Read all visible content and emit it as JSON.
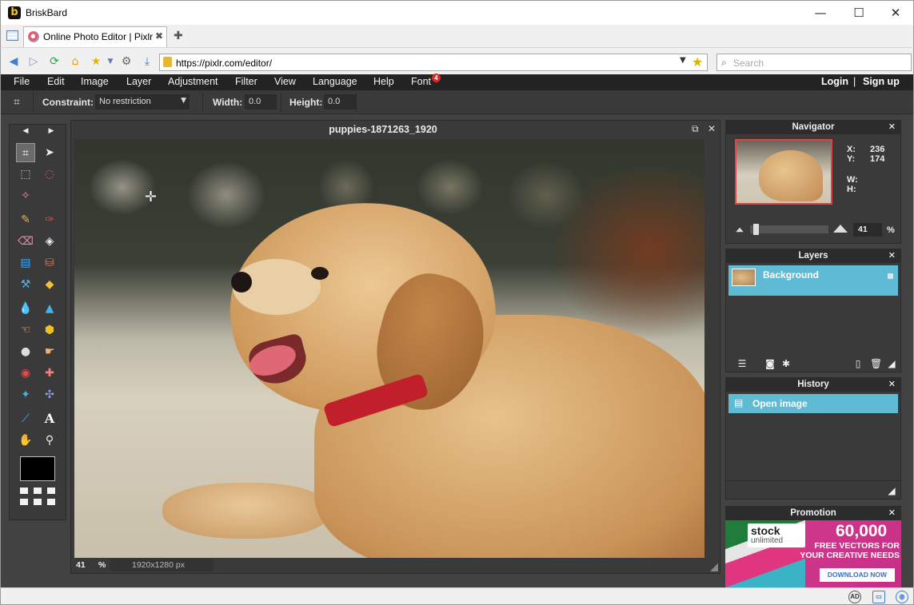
{
  "browser": {
    "app_title": "BriskBard",
    "tab": {
      "label": "Online Photo Editor | Pixlr"
    },
    "url": "https://pixlr.com/editor/",
    "search_placeholder": "Search"
  },
  "menu": {
    "items": [
      "File",
      "Edit",
      "Image",
      "Layer",
      "Adjustment",
      "Filter",
      "View",
      "Language",
      "Help",
      "Font"
    ],
    "font_badge": "4",
    "login": "Login",
    "separator": "|",
    "signup": "Sign up"
  },
  "options": {
    "constraint_label": "Constraint:",
    "constraint_value": "No restriction",
    "width_label": "Width:",
    "width_value": "0.0",
    "height_label": "Height:",
    "height_value": "0.0"
  },
  "document": {
    "title": "puppies-1871263_1920",
    "zoom": "41",
    "zoom_unit": "%",
    "dimensions": "1920x1280 px"
  },
  "navigator": {
    "title": "Navigator",
    "x_label": "X:",
    "x_value": "236",
    "y_label": "Y:",
    "y_value": "174",
    "w_label": "W:",
    "h_label": "H:",
    "zoom_value": "41",
    "zoom_unit": "%"
  },
  "layers": {
    "title": "Layers",
    "items": [
      {
        "name": "Background"
      }
    ]
  },
  "history": {
    "title": "History",
    "items": [
      {
        "name": "Open image"
      }
    ]
  },
  "promotion": {
    "title": "Promotion",
    "logo_line1": "stock",
    "logo_line2": "unlimited",
    "headline": "60,000",
    "subline1": "FREE VECTORS FOR",
    "subline2": "YOUR CREATIVE NEEDS",
    "button": "DOWNLOAD NOW"
  },
  "colors": {
    "accent": "#5fbad3",
    "menubar": "#232323",
    "panel": "#3a3a3a",
    "badge": "#e02626"
  }
}
